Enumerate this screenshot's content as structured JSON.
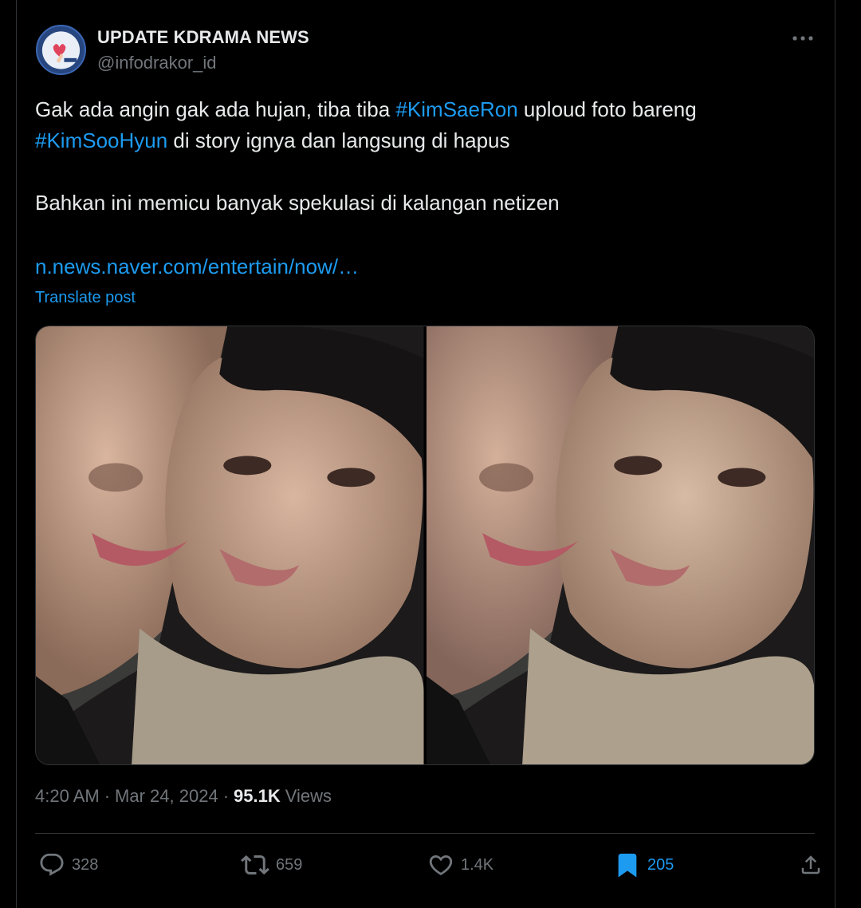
{
  "author": {
    "name": "UPDATE KDRAMA NEWS",
    "handle": "@infodrakor_id"
  },
  "tweet": {
    "line1_pre": "Gak ada angin gak ada hujan, tiba tiba ",
    "hashtag1": "#KimSaeRon",
    "line1_post": " uploud foto bareng",
    "hashtag2": "#KimSooHyun",
    "line2_post": " di story ignya dan langsung di hapus",
    "paragraph2": "Bahkan ini memicu banyak spekulasi di kalangan netizen",
    "link": "n.news.naver.com/entertain/now/…",
    "translate_label": "Translate post"
  },
  "meta": {
    "time": "4:20 AM",
    "sep1": "·",
    "date": "Mar 24, 2024",
    "sep2": "·",
    "views_count": "95.1K",
    "views_label": "Views"
  },
  "actions": {
    "replies": "328",
    "reposts": "659",
    "likes": "1.4K",
    "bookmarks": "205"
  },
  "colors": {
    "background": "#000000",
    "text": "#e7e9ea",
    "muted": "#71767b",
    "accent": "#1d9bf0",
    "border": "#2f3336"
  },
  "icons": [
    "more-icon",
    "reply-icon",
    "repost-icon",
    "like-icon",
    "bookmark-icon",
    "share-icon"
  ]
}
